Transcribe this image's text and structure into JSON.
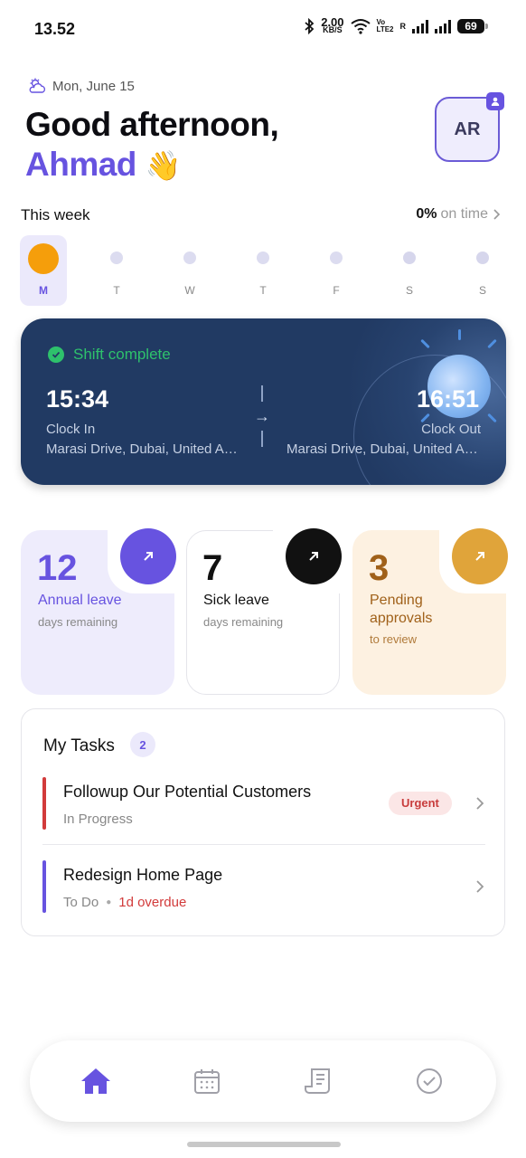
{
  "status_bar": {
    "time": "13.52",
    "speed_value": "2.00",
    "speed_unit": "KB/S",
    "volte_top": "Vo",
    "volte_bottom": "LTE2",
    "roaming": "R",
    "battery": "69"
  },
  "header": {
    "date": "Mon, June 15",
    "greeting": "Good afternoon,",
    "name": "Ahmad",
    "wave": "👋",
    "avatar_initials": "AR"
  },
  "week": {
    "title": "This week",
    "percent": "0%",
    "percent_label": "on time",
    "days": [
      "M",
      "T",
      "W",
      "T",
      "F",
      "S",
      "S"
    ]
  },
  "shift": {
    "status": "Shift complete",
    "clock_in_time": "15:34",
    "clock_in_label": "Clock In",
    "clock_in_location": "Marasi Drive, Dubai, United Arab Emirates",
    "clock_out_time": "16:51",
    "clock_out_label": "Clock Out",
    "clock_out_location": "Marasi Drive, Dubai, United Arab Emirates",
    "arrow": "→"
  },
  "leave": {
    "annual": {
      "count": "12",
      "title": "Annual leave",
      "sub": "days remaining",
      "accent": "#6753e0"
    },
    "sick": {
      "count": "7",
      "title": "Sick leave",
      "sub": "days remaining",
      "accent": "#111111"
    },
    "approvals": {
      "count": "3",
      "title_line1": "Pending",
      "title_line2": "approvals",
      "sub": "to review",
      "accent": "#e0a43a"
    }
  },
  "tasks": {
    "title": "My Tasks",
    "count": "2",
    "items": [
      {
        "title": "Followup Our Potential Customers",
        "status": "In Progress",
        "tag": "Urgent",
        "color": "#d23b3b"
      },
      {
        "title": "Redesign Home Page",
        "status": "To Do",
        "overdue": "1d overdue",
        "color": "#6753e0"
      }
    ]
  },
  "nav": {
    "icons": [
      "home-icon",
      "calendar-icon",
      "receipt-icon",
      "check-circle-icon"
    ],
    "active_color": "#6753e0"
  }
}
